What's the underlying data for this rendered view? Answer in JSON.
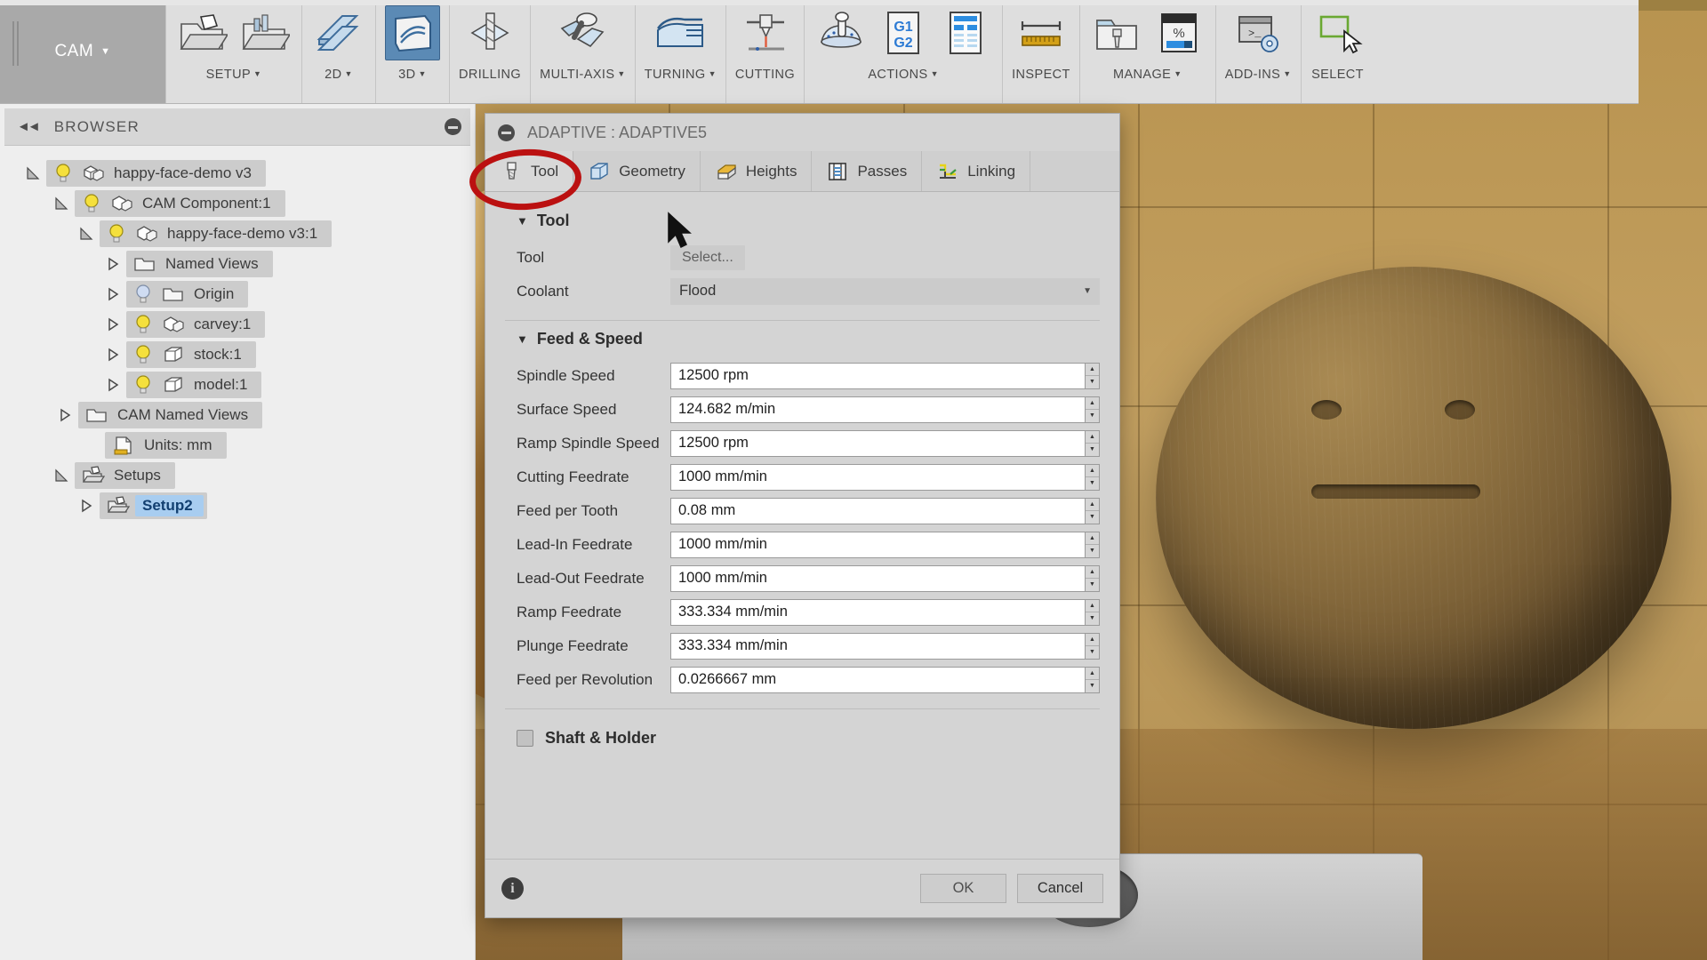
{
  "ribbon": {
    "tab_label": "CAM",
    "tab_caret": "▼",
    "groups": [
      {
        "label": "SETUP",
        "caret": "▼",
        "icons": [
          "setup-folder-icon",
          "setup-folder-config-icon"
        ]
      },
      {
        "label": "2D",
        "caret": "▼",
        "icons": [
          "toolpath-2d-icon"
        ]
      },
      {
        "label": "3D",
        "caret": "▼",
        "icons": [
          "toolpath-3d-icon"
        ]
      },
      {
        "label": "DRILLING",
        "caret": "",
        "icons": [
          "drilling-icon"
        ]
      },
      {
        "label": "MULTI-AXIS",
        "caret": "▼",
        "icons": [
          "multi-axis-icon"
        ]
      },
      {
        "label": "TURNING",
        "caret": "▼",
        "icons": [
          "turning-icon"
        ]
      },
      {
        "label": "CUTTING",
        "caret": "",
        "icons": [
          "cutting-icon"
        ]
      },
      {
        "label": "ACTIONS",
        "caret": "▼",
        "icons": [
          "simulate-icon",
          "g1-g2-post-icon",
          "setup-sheet-icon"
        ]
      },
      {
        "label": "INSPECT",
        "caret": "",
        "icons": [
          "measure-ruler-icon"
        ]
      },
      {
        "label": "MANAGE",
        "caret": "▼",
        "icons": [
          "tool-library-icon",
          "machining-time-icon"
        ]
      },
      {
        "label": "ADD-INS",
        "caret": "▼",
        "icons": [
          "script-addins-icon"
        ]
      },
      {
        "label": "SELECT",
        "caret": "",
        "icons": [
          "select-cursor-icon"
        ]
      }
    ]
  },
  "browser": {
    "title": "BROWSER",
    "collapse_icon": "collapse-left-icon",
    "minimize_icon": "minus-circle-icon",
    "tree": [
      {
        "label": "happy-face-demo v3",
        "indent": 0,
        "twist": "expanded",
        "bulb": "on",
        "icon": "component-icon",
        "selected": false
      },
      {
        "label": "CAM Component:1",
        "indent": 1,
        "twist": "expanded",
        "bulb": "on",
        "icon": "component-icon",
        "selected": false
      },
      {
        "label": "happy-face-demo v3:1",
        "indent": 2,
        "twist": "expanded",
        "bulb": "on",
        "icon": "component-icon",
        "selected": false
      },
      {
        "label": "Named Views",
        "indent": 3,
        "twist": "collapsed",
        "bulb": "none",
        "icon": "folder-icon",
        "selected": false
      },
      {
        "label": "Origin",
        "indent": 3,
        "twist": "collapsed",
        "bulb": "blue",
        "icon": "folder-icon",
        "selected": false
      },
      {
        "label": "carvey:1",
        "indent": 3,
        "twist": "collapsed",
        "bulb": "on",
        "icon": "component-icon",
        "selected": false
      },
      {
        "label": "stock:1",
        "indent": 3,
        "twist": "collapsed",
        "bulb": "on",
        "icon": "body-icon",
        "selected": false
      },
      {
        "label": "model:1",
        "indent": 3,
        "twist": "collapsed",
        "bulb": "on",
        "icon": "body-icon",
        "selected": false
      },
      {
        "label": "CAM Named Views",
        "indent": 2,
        "twist": "collapsed",
        "bulb": "none",
        "icon": "folder-icon",
        "selected": false
      },
      {
        "label": "Units: mm",
        "indent": 2,
        "twist": "none",
        "bulb": "none",
        "icon": "units-doc-icon",
        "selected": false
      },
      {
        "label": "Setups",
        "indent": 1,
        "twist": "expanded",
        "bulb": "none",
        "icon": "setup-folder-icon",
        "selected": false
      },
      {
        "label": "Setup2",
        "indent": 2,
        "twist": "collapsed",
        "bulb": "none",
        "icon": "setup-folder-icon",
        "selected": true
      }
    ]
  },
  "dialog": {
    "title": "ADAPTIVE : ADAPTIVE5",
    "minimize_icon": "minus-circle-icon",
    "tabs": [
      {
        "label": "Tool",
        "icon": "tool-endmill-icon",
        "active": true
      },
      {
        "label": "Geometry",
        "icon": "geometry-icon",
        "active": false
      },
      {
        "label": "Heights",
        "icon": "heights-icon",
        "active": false
      },
      {
        "label": "Passes",
        "icon": "passes-icon",
        "active": false
      },
      {
        "label": "Linking",
        "icon": "linking-icon",
        "active": false
      }
    ],
    "sections": [
      {
        "title": "Tool",
        "collapse_glyph": "▼",
        "fields": [
          {
            "label": "Tool",
            "type": "button",
            "value": "Select..."
          },
          {
            "label": "Coolant",
            "type": "combo",
            "value": "Flood",
            "arrow": "▼"
          }
        ]
      },
      {
        "title": "Feed & Speed",
        "collapse_glyph": "▼",
        "fields": [
          {
            "label": "Spindle Speed",
            "type": "spin",
            "value": "12500 rpm"
          },
          {
            "label": "Surface Speed",
            "type": "spin",
            "value": "124.682 m/min"
          },
          {
            "label": "Ramp Spindle Speed",
            "type": "spin",
            "value": "12500 rpm"
          },
          {
            "label": "Cutting Feedrate",
            "type": "spin",
            "value": "1000 mm/min"
          },
          {
            "label": "Feed per Tooth",
            "type": "spin",
            "value": "0.08 mm"
          },
          {
            "label": "Lead-In Feedrate",
            "type": "spin",
            "value": "1000 mm/min"
          },
          {
            "label": "Lead-Out Feedrate",
            "type": "spin",
            "value": "1000 mm/min"
          },
          {
            "label": "Ramp Feedrate",
            "type": "spin",
            "value": "333.334 mm/min"
          },
          {
            "label": "Plunge Feedrate",
            "type": "spin",
            "value": "333.334 mm/min"
          },
          {
            "label": "Feed per Revolution",
            "type": "spin",
            "value": "0.0266667 mm"
          }
        ]
      }
    ],
    "shaft_holder": {
      "label": "Shaft & Holder",
      "checked": false
    },
    "footer": {
      "info_glyph": "i",
      "ok_label": "OK",
      "cancel_label": "Cancel"
    }
  },
  "annotation": {
    "shape": "red-ellipse-highlight",
    "target": "tool-tab"
  },
  "colors": {
    "accent_blue": "#5b8ab5",
    "annotation_red": "#bb1111",
    "selection_blue": "#a8cdf0",
    "viewport_tan": "#b8934f"
  }
}
